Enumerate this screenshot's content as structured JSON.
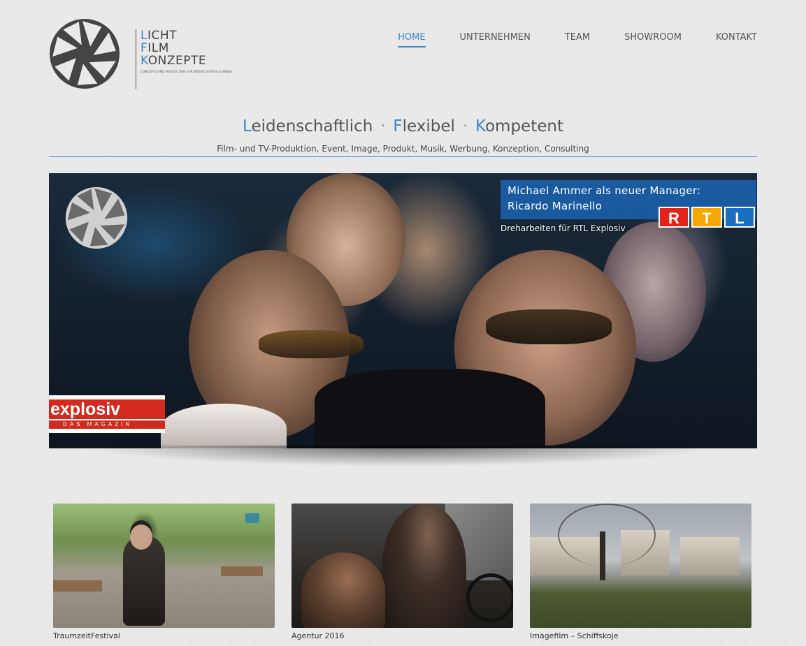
{
  "brand": {
    "lines": [
      {
        "first": "L",
        "rest": "ICHT"
      },
      {
        "first": "F",
        "rest": "ILM"
      },
      {
        "first": "K",
        "rest": "ONZEPTE"
      }
    ],
    "tagline_small": "CONCEPTS AND PRODUCTION FOR BROADCASTING & MEDIA"
  },
  "nav": {
    "items": [
      "HOME",
      "UNTERNEHMEN",
      "TEAM",
      "SHOWROOM",
      "KONTAKT"
    ],
    "active": "HOME"
  },
  "tagline": {
    "words": [
      {
        "first": "L",
        "rest": "eidenschaftlich"
      },
      {
        "first": "F",
        "rest": "lexibel"
      },
      {
        "first": "K",
        "rest": "ompetent"
      }
    ],
    "separator": "·",
    "subline": "Film- und TV-Produktion, Event, Image, Produkt, Musik, Werbung, Konzeption, Consulting"
  },
  "hero": {
    "headline_1": "Michael Ammer als neuer Manager:",
    "headline_2": "Ricardo Marinello",
    "subtitle": "Dreharbeiten für RTL Explosiv",
    "rtl": [
      "R",
      "T",
      "L"
    ],
    "explosiv_word": "explosiv",
    "explosiv_sub": "DAS MAGAZIN"
  },
  "thumbnails": [
    {
      "caption": "TraumzeitFestival"
    },
    {
      "caption": "Agentur 2016"
    },
    {
      "caption": "Imagefilm – Schiffskoje"
    }
  ],
  "colors": {
    "accent": "#3a86c8",
    "news_box": "#1a5ea8",
    "explosiv_red": "#d22a1f"
  },
  "icons": {
    "logo": "camera-aperture-icon"
  }
}
